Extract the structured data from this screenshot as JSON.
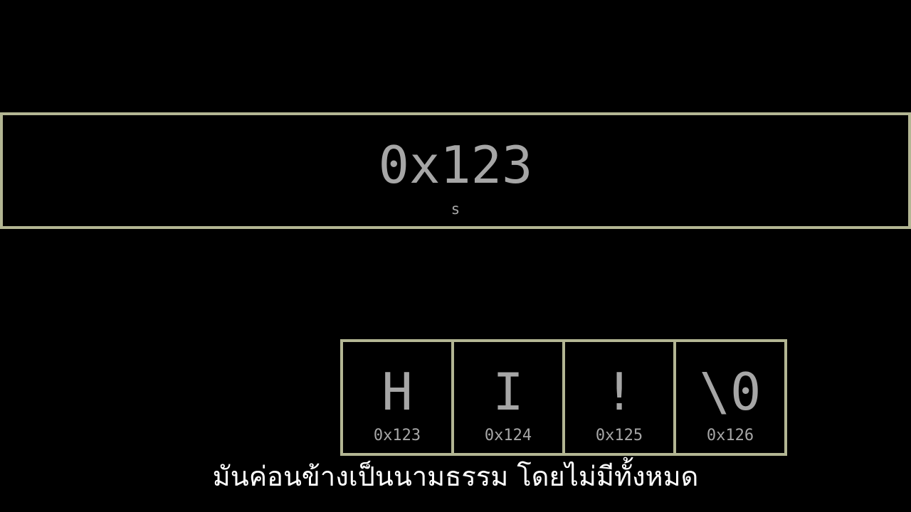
{
  "pointer": {
    "value": "0x123",
    "name": "s"
  },
  "array": {
    "cells": [
      {
        "char": "H",
        "address": "0x123"
      },
      {
        "char": "I",
        "address": "0x124"
      },
      {
        "char": "!",
        "address": "0x125"
      },
      {
        "char": "\\0",
        "address": "0x126"
      }
    ]
  },
  "subtitle": "มันค่อนข้างเป็นนามธรรม โดยไม่มีทั้งหมด",
  "colors": {
    "background": "#000000",
    "border": "#b3b693",
    "text": "#a6a6a6",
    "subtitle": "#ffffff"
  }
}
